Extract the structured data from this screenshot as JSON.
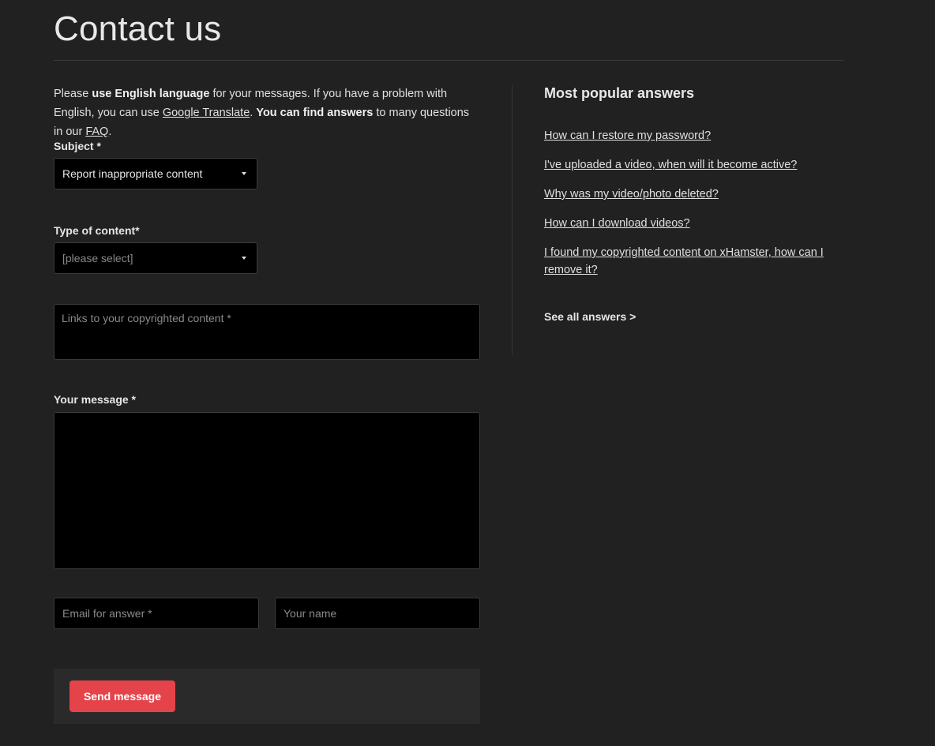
{
  "page_title": "Contact us",
  "intro": {
    "p1": "Please ",
    "b1": "use English language",
    "p2": " for your messages. If you have a problem with English, you can use ",
    "link1": "Google Translate",
    "p3": ". ",
    "b2": "You can find answers",
    "p4": " to many questions in our ",
    "link2": "FAQ",
    "p5": "."
  },
  "form": {
    "subject_label": "Subject *",
    "subject_value": "Report inappropriate content",
    "type_label": "Type of content*",
    "type_placeholder": "[please select]",
    "links_placeholder": "Links to your copyrighted content *",
    "message_label": "Your message *",
    "message_value": "",
    "email_placeholder": "Email for answer *",
    "name_placeholder": "Your name",
    "send_label": "Send message"
  },
  "sidebar": {
    "title": "Most popular answers",
    "items": [
      "How can I restore my password?",
      "I've uploaded a video, when will it become active?",
      "Why was my video/photo deleted?",
      "How can I download videos?",
      "I found my copyrighted content on xHamster, how can I remove it?"
    ],
    "see_all": "See all answers >"
  },
  "colors": {
    "background": "#212121",
    "field_background": "#000000",
    "accent": "#e5434a"
  }
}
